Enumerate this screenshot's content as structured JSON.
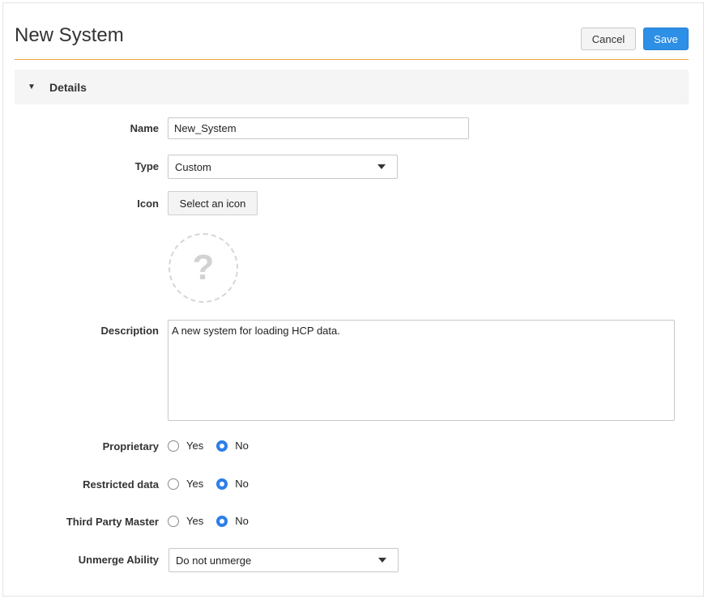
{
  "page": {
    "title": "New System",
    "cancel_label": "Cancel",
    "save_label": "Save"
  },
  "section": {
    "title": "Details",
    "toggle_glyph": "▼"
  },
  "form": {
    "name": {
      "label": "Name",
      "value": "New_System"
    },
    "type": {
      "label": "Type",
      "value": "Custom"
    },
    "icon": {
      "label": "Icon",
      "button_label": "Select an icon",
      "placeholder_glyph": "?"
    },
    "description": {
      "label": "Description",
      "value": "A new system for loading HCP data."
    },
    "proprietary": {
      "label": "Proprietary",
      "yes_label": "Yes",
      "no_label": "No",
      "selected": "No"
    },
    "restricted_data": {
      "label": "Restricted data",
      "yes_label": "Yes",
      "no_label": "No",
      "selected": "No"
    },
    "third_party_master": {
      "label": "Third Party Master",
      "yes_label": "Yes",
      "no_label": "No",
      "selected": "No"
    },
    "unmerge_ability": {
      "label": "Unmerge Ability",
      "value": "Do not unmerge"
    }
  },
  "colors": {
    "accent_rule": "#f0a23b",
    "primary_button": "#2d8fe6",
    "radio_selected": "#2d7fe8"
  }
}
